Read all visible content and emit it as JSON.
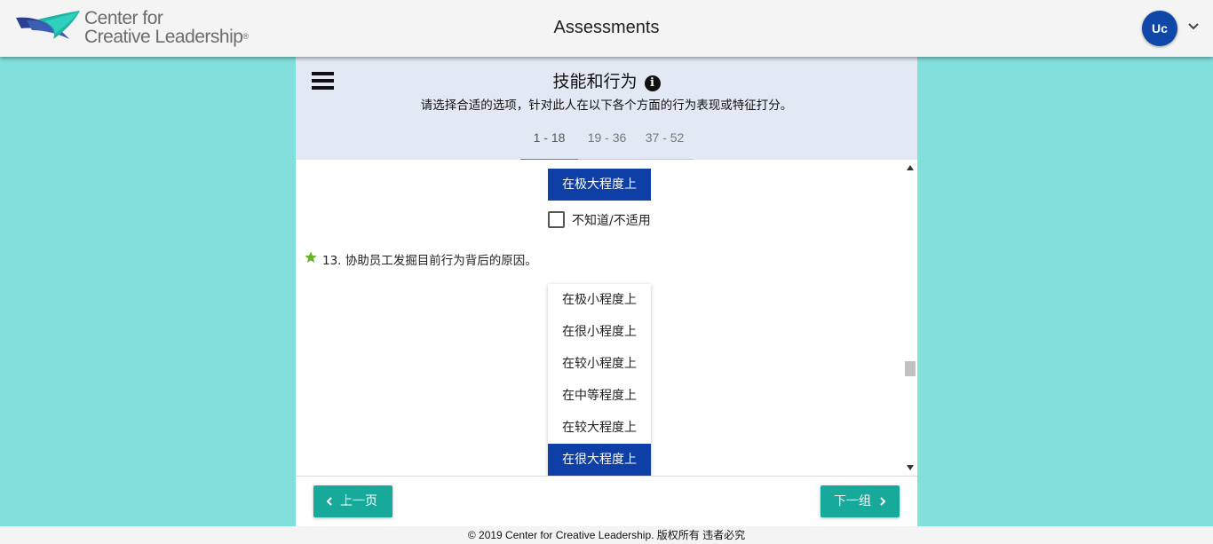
{
  "header": {
    "logo_line1": "Center for",
    "logo_line2": "Creative Leadership",
    "logo_reg": "®",
    "title": "Assessments",
    "avatar_initials": "Uc"
  },
  "section": {
    "title": "技能和行为",
    "subtitle": "请选择合适的选项，针对此人在以下各个方面的行为表现或特征打分。"
  },
  "tabs": [
    {
      "label": "1 - 18",
      "active": true
    },
    {
      "label": "19 - 36",
      "active": false
    },
    {
      "label": "37 - 52",
      "active": false
    }
  ],
  "previous_question": {
    "selected_option": "在极大程度上",
    "not_applicable_label": "不知道/不适用",
    "not_applicable_checked": false
  },
  "question": {
    "text": "13. 协助员工发掘目前行为背后的原因。",
    "options": [
      {
        "label": "在极小程度上",
        "selected": false
      },
      {
        "label": "在很小程度上",
        "selected": false
      },
      {
        "label": "在较小程度上",
        "selected": false
      },
      {
        "label": "在中等程度上",
        "selected": false
      },
      {
        "label": "在较大程度上",
        "selected": false
      },
      {
        "label": "在很大程度上",
        "selected": true
      }
    ]
  },
  "nav": {
    "prev_label": "上一页",
    "next_label": "下一组"
  },
  "footer": {
    "text": "© 2019 Center for Creative Leadership. 版权所有 违者必究"
  },
  "colors": {
    "background": "#82e0dc",
    "header_bg": "#f4f4f4",
    "panel_head_bg": "#e2e8f4",
    "accent_teal": "#17a99a",
    "selected_blue": "#0d3fa6",
    "avatar_blue": "#0f47a8",
    "star_green": "#6bb42a"
  },
  "icons": {
    "menu": "hamburger-icon",
    "info": "info-icon",
    "user_menu": "chevron-down-icon",
    "question_marker": "star-icon",
    "prev": "chevron-left-icon",
    "next": "chevron-right-icon"
  }
}
